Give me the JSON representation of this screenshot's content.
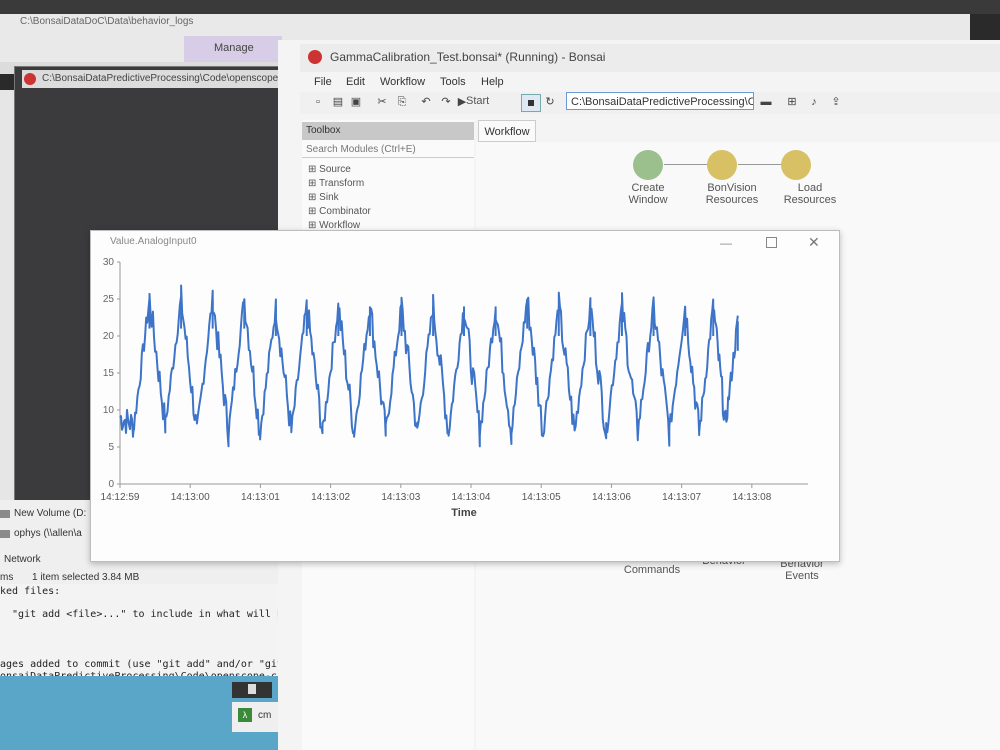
{
  "explorer": {
    "title": "C:\\BonsaiDataDoC\\Data\\behavior_logs",
    "manage_tab": "Manage"
  },
  "vscode": {
    "title": "C:\\BonsaiDataPredictiveProcessing\\Code\\openscope-comm"
  },
  "files": {
    "new_volume": "New Volume (D:",
    "ophys": "ophys (\\\\allen\\a",
    "network": "Network",
    "status_items": "ms",
    "status_selected": "1 item selected  3.84 MB"
  },
  "terminal": {
    "lines": [
      "ked files:",
      "  \"git add <file>...\" to include in what will be",
      "ages added to commit (use \"git add\" and/or \"git",
      "onsaiDataPredictiveProcessing\\Code\\openscope-c"
    ],
    "cmd_label": "cm"
  },
  "bonsai": {
    "title": "GammaCalibration_Test.bonsai* (Running) - Bonsai",
    "menu": [
      "File",
      "Edit",
      "Workflow",
      "Tools",
      "Help"
    ],
    "start_label": "Start",
    "path": "C:\\BonsaiDataPredictiveProcessing\\C",
    "toolbox": {
      "header": "Toolbox",
      "search_placeholder": "Search Modules (Ctrl+E)",
      "categories": [
        "Source",
        "Transform",
        "Sink",
        "Combinator",
        "Workflow"
      ]
    },
    "workflow_tab": "Workflow",
    "nodes": [
      {
        "line1": "Create",
        "line2": "Window",
        "color": "#9bc08e"
      },
      {
        "line1": "BonVision",
        "line2": "Resources",
        "color": "#d8c064"
      },
      {
        "line1": "Load",
        "line2": "Resources",
        "color": "#d8c064"
      }
    ],
    "lower_nodes": [
      {
        "line1": "Behavior",
        "line2": "Commands"
      },
      {
        "line1": "Behavior",
        "line2": ""
      },
      {
        "line1": "Behavior",
        "line2": "Events"
      }
    ]
  },
  "plot_window": {
    "title": "Value.AnalogInput0",
    "minimize": "—",
    "close": "✕"
  },
  "chart_data": {
    "type": "line",
    "title": "",
    "xlabel": "Time",
    "ylabel": "",
    "ylim": [
      0,
      30
    ],
    "y_ticks": [
      "0",
      "5",
      "10",
      "15",
      "20",
      "25",
      "30"
    ],
    "x_ticks": [
      "14:12:59",
      "14:13:00",
      "14:13:01",
      "14:13:02",
      "14:13:03",
      "14:13:04",
      "14:13:05",
      "14:13:06",
      "14:13:07",
      "14:13:08"
    ],
    "series_color": "#3d74c8",
    "grid": false,
    "series": [
      {
        "peak_times": [
          0.42,
          0.87,
          1.32,
          1.77,
          2.22,
          2.66,
          3.11,
          3.56,
          4.01,
          4.46,
          4.9,
          5.35,
          5.8,
          6.25,
          6.7,
          7.15,
          7.6,
          8.05,
          8.45,
          8.8
        ],
        "peak_values": [
          25,
          25,
          25,
          25,
          24,
          24,
          24,
          24,
          24,
          24,
          24,
          24,
          25,
          24,
          24,
          24,
          24,
          24,
          24,
          22
        ],
        "trough_values": [
          5,
          5,
          4,
          4,
          4,
          4,
          4,
          4,
          4,
          4,
          4,
          4,
          4,
          4,
          4,
          4,
          4,
          4,
          4,
          5
        ],
        "x_start": 0.0,
        "x_end": 8.82
      }
    ]
  }
}
